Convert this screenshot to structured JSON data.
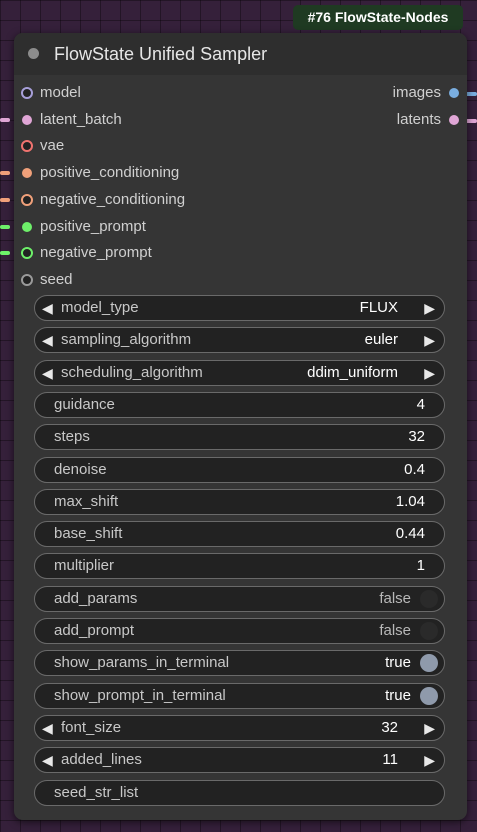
{
  "badge": "#76 FlowState-Nodes",
  "node": {
    "title": "FlowState Unified Sampler"
  },
  "inputs": [
    {
      "label": "model",
      "color": "#a79fd9",
      "style": "ring",
      "wire": false
    },
    {
      "label": "latent_batch",
      "color": "#e0a6d6",
      "style": "dot",
      "wire": true
    },
    {
      "label": "vae",
      "color": "#f0736f",
      "style": "ring",
      "wire": false
    },
    {
      "label": "positive_conditioning",
      "color": "#f0a07a",
      "style": "dot",
      "wire": true
    },
    {
      "label": "negative_conditioning",
      "color": "#f0a07a",
      "style": "ring",
      "wire": true
    },
    {
      "label": "positive_prompt",
      "color": "#6ef06a",
      "style": "dot",
      "wire": true
    },
    {
      "label": "negative_prompt",
      "color": "#6ef06a",
      "style": "ring",
      "wire": true
    },
    {
      "label": "seed",
      "color": "#9a9a9a",
      "style": "ring",
      "wire": false
    }
  ],
  "outputs": [
    {
      "label": "images",
      "color": "#7aaee0"
    },
    {
      "label": "latents",
      "color": "#e0a6d6"
    }
  ],
  "widgets": [
    {
      "kind": "combo",
      "label": "model_type",
      "value": "FLUX"
    },
    {
      "kind": "combo",
      "label": "sampling_algorithm",
      "value": "euler"
    },
    {
      "kind": "combo",
      "label": "scheduling_algorithm",
      "value": "ddim_uniform"
    },
    {
      "kind": "number",
      "label": "guidance",
      "value": "4"
    },
    {
      "kind": "number",
      "label": "steps",
      "value": "32"
    },
    {
      "kind": "number",
      "label": "denoise",
      "value": "0.4"
    },
    {
      "kind": "number",
      "label": "max_shift",
      "value": "1.04"
    },
    {
      "kind": "number",
      "label": "base_shift",
      "value": "0.44"
    },
    {
      "kind": "number",
      "label": "multiplier",
      "value": "1"
    },
    {
      "kind": "toggle",
      "label": "add_params",
      "value": "false"
    },
    {
      "kind": "toggle",
      "label": "add_prompt",
      "value": "false"
    },
    {
      "kind": "toggle",
      "label": "show_params_in_terminal",
      "value": "true"
    },
    {
      "kind": "toggle",
      "label": "show_prompt_in_terminal",
      "value": "true"
    },
    {
      "kind": "combo",
      "label": "font_size",
      "value": "32"
    },
    {
      "kind": "combo",
      "label": "added_lines",
      "value": "11"
    },
    {
      "kind": "text",
      "label": "seed_str_list",
      "value": ""
    }
  ],
  "icons": {
    "arrow_left": "◀",
    "arrow_right": "▶"
  }
}
